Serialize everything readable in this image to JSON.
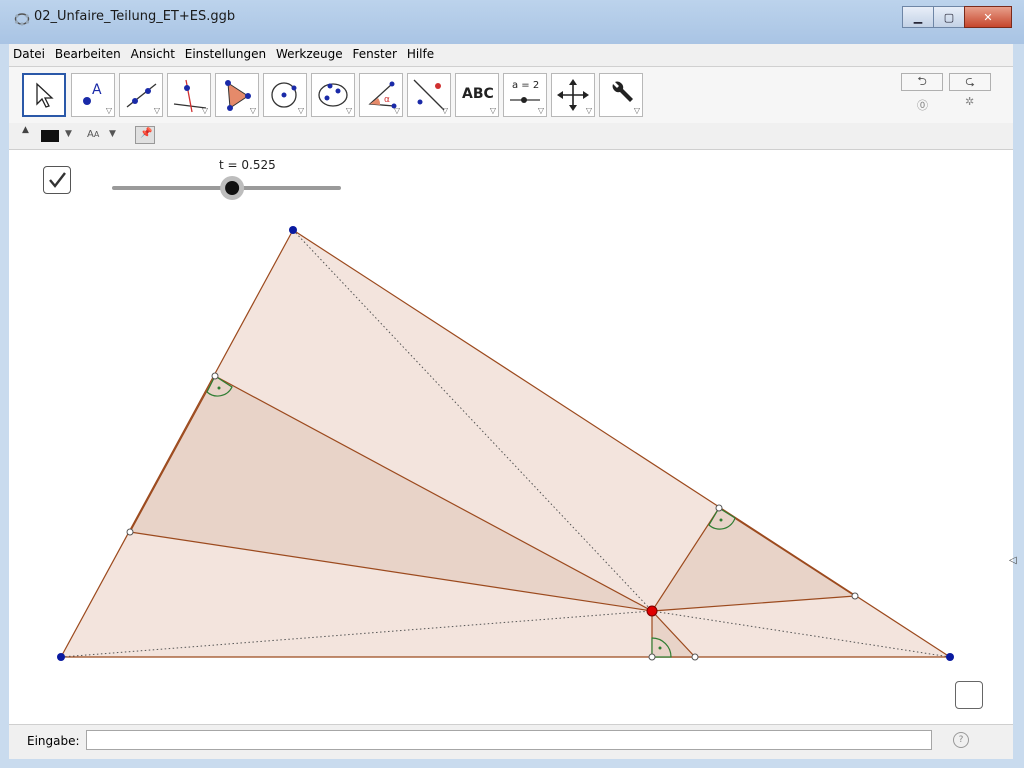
{
  "window": {
    "title": "02_Unfaire_Teilung_ET+ES.ggb"
  },
  "menu": [
    "Datei",
    "Bearbeiten",
    "Ansicht",
    "Einstellungen",
    "Werkzeuge",
    "Fenster",
    "Hilfe"
  ],
  "toolbar": {
    "tools": [
      "move-tool",
      "point-tool",
      "line-tool",
      "perpendicular-tool",
      "polygon-tool",
      "circle-tool",
      "ellipse-tool",
      "angle-tool",
      "reflect-tool",
      "text-tool",
      "slider-tool",
      "move-graphics-tool",
      "general-tools"
    ],
    "text_tool_label": "ABC",
    "slider_tool_label": "a = 2"
  },
  "slider": {
    "label": "t = 0.525",
    "value": 0.525
  },
  "input_bar": {
    "label": "Eingabe:",
    "value": ""
  },
  "colors": {
    "fill": "#f3e4dd",
    "fill_dark": "#e8d3c8",
    "edge": "#9c4a1e",
    "right_angle": "#2e7d32",
    "point": "#0a1aa0",
    "center_point": "#e00000"
  }
}
